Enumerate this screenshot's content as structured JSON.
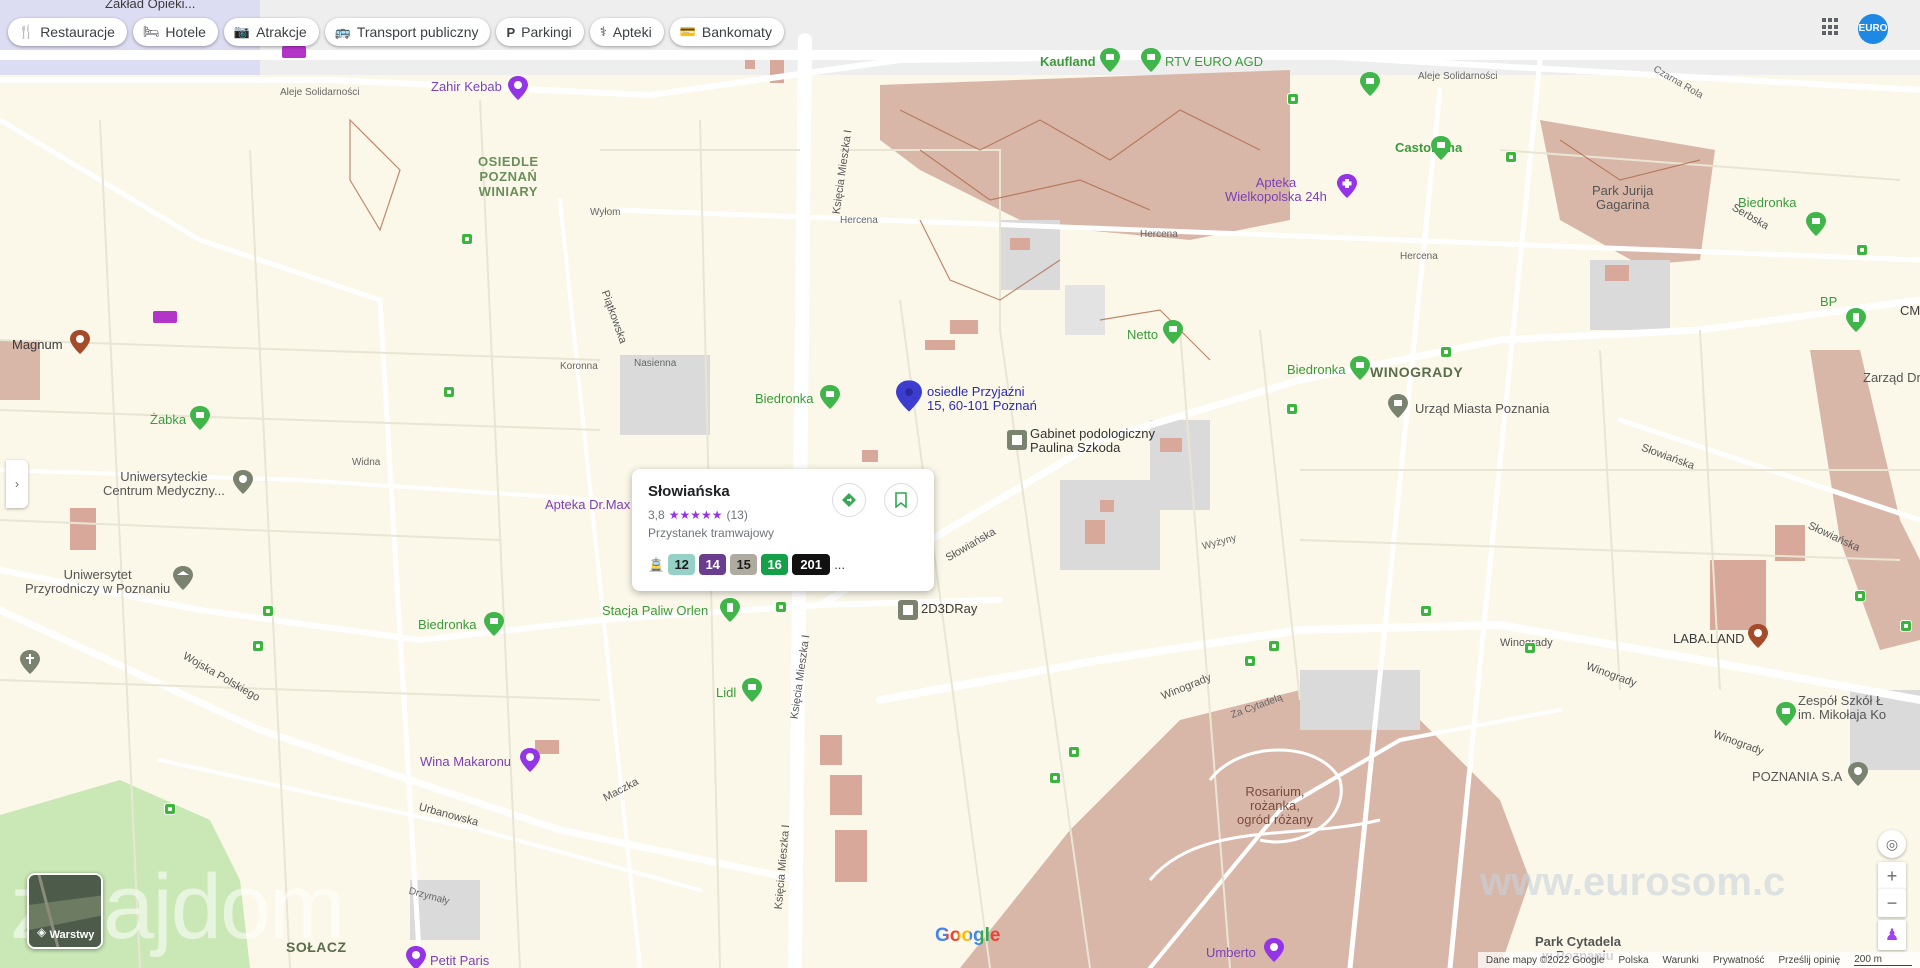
{
  "chips": [
    {
      "label": "Restauracje",
      "icon": "fork-knife-icon",
      "glyph": "🍴"
    },
    {
      "label": "Hotele",
      "icon": "bed-icon",
      "glyph": "🛏"
    },
    {
      "label": "Atrakcje",
      "icon": "camera-icon",
      "glyph": "📷"
    },
    {
      "label": "Transport publiczny",
      "icon": "bus-icon",
      "glyph": "🚌"
    },
    {
      "label": "Parkingi",
      "icon": "parking-icon",
      "glyph": "P"
    },
    {
      "label": "Apteki",
      "icon": "pharmacy-icon",
      "glyph": "⚕"
    },
    {
      "label": "Bankomaty",
      "icon": "atm-icon",
      "glyph": "💳"
    }
  ],
  "top_left_cut": "Zakład Opieki...",
  "avatar": "EURO",
  "places": {
    "zahir_kebab": "Zahir Kebab",
    "kaufland": "Kaufland",
    "rtv_euro": "RTV EURO AGD",
    "castorama": "Castorama",
    "apteka_wlkp": "Apteka\nWielkopolska 24h",
    "park_jurija": "Park Jurija\nGagarina",
    "biedronka": "Biedronka",
    "bp": "BP",
    "cm": "CM",
    "zarzad": "Zarząd Dró",
    "magnum": "Magnum",
    "zabka": "Żabka",
    "netto": "Netto",
    "winogrady": "WINOGRADY",
    "urzad": "Urząd Miasta Poznania",
    "uni_med": "Uniwersyteckie\nCentrum Medyczny...",
    "apteka_drmax": "Apteka Dr.Max",
    "address": "osiedle Przyjaźni\n15, 60-101 Poznań",
    "gabinet": "Gabinet podologiczny\nPaulina Szkoda",
    "uni_przyr": "Uniwersytet\nPrzyrodniczy w Poznaniu",
    "stacja_orlen": "Stacja Paliw Orlen",
    "lidl": "Lidl",
    "d3dray": "2D3DRay",
    "laba": "LABA.LAND",
    "zespol": "Zespół Szkół Ł\nim. Mikołaja Ko",
    "poznania": "POZNANIA S.A",
    "wina": "Wina Makaronu",
    "rosarium": "Rosarium,\nrożanka,\nogród różany",
    "park_cytadela": "Park Cytadela\nw Poznaniu",
    "umberto": "Umberto",
    "petit_paris": "Petit Paris",
    "solacz": "SOŁACZ",
    "osiedle_winiary": "OSIEDLE\nPOZNAŃ\nWINIARY"
  },
  "streets": {
    "aleje_sol1": "Aleje Solidarności",
    "aleje_sol2": "Aleje Solidarności",
    "hercena1": "Hercena",
    "hercena2": "Hercena",
    "hercena3": "Hercena",
    "wylom": "Wyłom",
    "koronna": "Koronna",
    "piatkowska": "Piątkowska",
    "nasienna": "Nasienna",
    "krolowej": "Księcia Mieszka I",
    "krolowej2": "Księcia Mieszka I",
    "krolowej3": "Księcia Mieszka I",
    "slowianska1": "Słowiańska",
    "slowianska2": "Słowiańska",
    "slowianska3": "Słowiańska",
    "winogrady1": "Winogrady",
    "winogrady2": "Winogrady",
    "winogrady3": "Winogrady",
    "winogrady4": "Winogrady",
    "wojska": "Wojska Polskiego",
    "urbanowska": "Urbanowska",
    "maczka": "Maczka",
    "serbska": "Serbska",
    "czarna_rola": "Czarna Rola",
    "za_cytadela": "Za Cytadelą",
    "jana_sobieskiego": "Drzymały",
    "widna": "Widna",
    "wyzyny": "Wyżyny"
  },
  "card": {
    "title": "Słowiańska",
    "rating": "3,8",
    "stars": "★★★★★",
    "reviews": "(13)",
    "subtitle": "Przystanek tramwajowy",
    "lines": [
      "12",
      "14",
      "15",
      "16",
      "201"
    ],
    "more": "...",
    "directions_icon": "directions-icon",
    "save_icon": "bookmark-icon"
  },
  "layers_label": "Warstwy",
  "google": "Google",
  "watermark_left": "znajdom",
  "watermark_right": "www.eurosom.c",
  "footer": [
    "Dane mapy ©2022 Google",
    "Polska",
    "Warunki",
    "Prywatność",
    "Prześlij opinię",
    "200 m"
  ],
  "colors": {
    "park": "#d9b7a8",
    "green_space": "#c9e8b5",
    "road": "#ffffff",
    "base": "#fbf8e9",
    "pin_blue": "#3c3ccf",
    "line_green": "#3db53d"
  }
}
